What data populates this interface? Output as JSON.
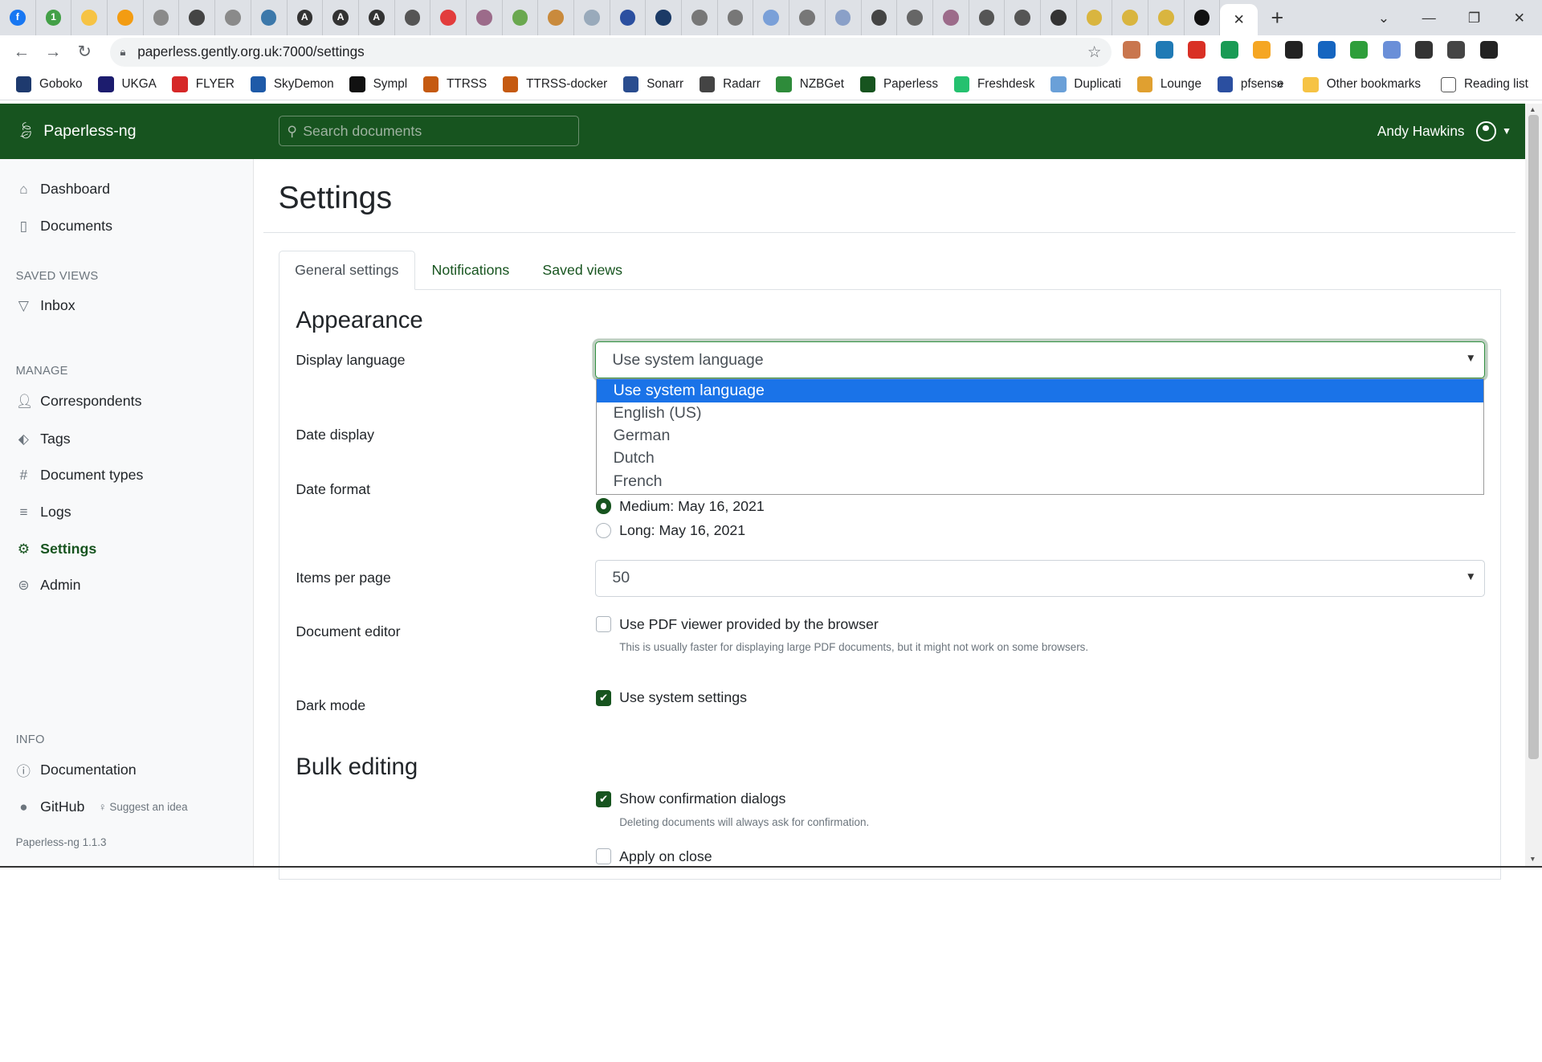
{
  "browser": {
    "favicons": [
      {
        "name": "facebook",
        "color": "#1877f2",
        "glyph": "f"
      },
      {
        "name": "one",
        "color": "#43a047",
        "glyph": "1"
      },
      {
        "name": "note",
        "color": "#f6c344",
        "glyph": ""
      },
      {
        "name": "ring",
        "color": "#f39c12",
        "glyph": ""
      },
      {
        "name": "globe",
        "color": "#8a8a8a",
        "glyph": ""
      },
      {
        "name": "globe-dark",
        "color": "#444",
        "glyph": ""
      },
      {
        "name": "globe2",
        "color": "#8a8a8a",
        "glyph": ""
      },
      {
        "name": "python",
        "color": "#3c78aa",
        "glyph": ""
      },
      {
        "name": "a1",
        "color": "#333",
        "glyph": "A"
      },
      {
        "name": "a2",
        "color": "#333",
        "glyph": "A"
      },
      {
        "name": "a3",
        "color": "#333",
        "glyph": "A"
      },
      {
        "name": "diamond",
        "color": "#555",
        "glyph": ""
      },
      {
        "name": "pce",
        "color": "#e23c3c",
        "glyph": ""
      },
      {
        "name": "u1",
        "color": "#9c6b8a",
        "glyph": ""
      },
      {
        "name": "map",
        "color": "#6aa84f",
        "glyph": ""
      },
      {
        "name": "bars",
        "color": "#c98a3c",
        "glyph": ""
      },
      {
        "name": "cloud",
        "color": "#9ab",
        "glyph": ""
      },
      {
        "name": "pf",
        "color": "#2b4fa0",
        "glyph": ""
      },
      {
        "name": "x",
        "color": "#1b3a66",
        "glyph": ""
      },
      {
        "name": "c1",
        "color": "#777",
        "glyph": ""
      },
      {
        "name": "c2",
        "color": "#777",
        "glyph": ""
      },
      {
        "name": "box",
        "color": "#7aa0d8",
        "glyph": ""
      },
      {
        "name": "c3",
        "color": "#777",
        "glyph": ""
      },
      {
        "name": "gear",
        "color": "#8aa0c8",
        "glyph": ""
      },
      {
        "name": "circle",
        "color": "#444",
        "glyph": ""
      },
      {
        "name": "i",
        "color": "#666",
        "glyph": ""
      },
      {
        "name": "u2",
        "color": "#9c6b8a",
        "glyph": ""
      },
      {
        "name": "g1",
        "color": "#555",
        "glyph": ""
      },
      {
        "name": "g2",
        "color": "#555",
        "glyph": ""
      },
      {
        "name": "htb",
        "color": "#333",
        "glyph": ""
      },
      {
        "name": "py1",
        "color": "#d9b53f",
        "glyph": ""
      },
      {
        "name": "py2",
        "color": "#d9b53f",
        "glyph": ""
      },
      {
        "name": "py3",
        "color": "#d9b53f",
        "glyph": ""
      },
      {
        "name": "github",
        "color": "#111",
        "glyph": ""
      }
    ],
    "active_tab_close": "✕",
    "new_tab": "+",
    "window": {
      "minimize": "—",
      "restore": "❐",
      "close": "✕"
    },
    "url": "paperless.gently.org.uk:7000/settings",
    "extensions": [
      "#c9764e",
      "#1f7ab5",
      "#d93025",
      "#1a9b55",
      "#f5a623",
      "#222",
      "#1565c0",
      "#2e9e3b",
      "#6a8fd8",
      "#333",
      "#444",
      "#222"
    ],
    "bookmarks": [
      {
        "label": "Goboko",
        "color": "#1e3a6e"
      },
      {
        "label": "UKGA",
        "color": "#1c1c6e"
      },
      {
        "label": "FLYER",
        "color": "#d62828"
      },
      {
        "label": "SkyDemon",
        "color": "#1e5aa8"
      },
      {
        "label": "Sympl",
        "color": "#111"
      },
      {
        "label": "TTRSS",
        "color": "#c55a11"
      },
      {
        "label": "TTRSS-docker",
        "color": "#c55a11"
      },
      {
        "label": "Sonarr",
        "color": "#2a4d8f"
      },
      {
        "label": "Radarr",
        "color": "#444"
      },
      {
        "label": "NZBGet",
        "color": "#2e8b3a"
      },
      {
        "label": "Paperless",
        "color": "#17541f"
      },
      {
        "label": "Freshdesk",
        "color": "#25c16f"
      },
      {
        "label": "Duplicati",
        "color": "#6aa0d8"
      },
      {
        "label": "Lounge",
        "color": "#e0a030"
      },
      {
        "label": "pfsense",
        "color": "#2b4fa0"
      }
    ],
    "bookmarks_more": "»",
    "other_bookmarks": "Other bookmarks",
    "reading_list": "Reading list"
  },
  "app": {
    "brand": "Paperless-ng",
    "search_placeholder": "Search documents",
    "user_name": "Andy Hawkins",
    "accent": "#17541f"
  },
  "sidebar": {
    "dashboard": "Dashboard",
    "documents": "Documents",
    "saved_views_heading": "SAVED VIEWS",
    "inbox": "Inbox",
    "manage_heading": "MANAGE",
    "correspondents": "Correspondents",
    "tags": "Tags",
    "document_types": "Document types",
    "logs": "Logs",
    "settings": "Settings",
    "admin": "Admin",
    "info_heading": "INFO",
    "documentation": "Documentation",
    "github": "GitHub",
    "suggest": "Suggest an idea",
    "version": "Paperless-ng 1.1.3"
  },
  "settings": {
    "title": "Settings",
    "tabs": [
      "General settings",
      "Notifications",
      "Saved views"
    ],
    "appearance_heading": "Appearance",
    "display_language_label": "Display language",
    "display_language_value": "Use system language",
    "language_options": [
      "Use system language",
      "English (US)",
      "German",
      "Dutch",
      "French"
    ],
    "date_display_label": "Date display",
    "date_format_label": "Date format",
    "date_format_medium": "Medium: May 16, 2021",
    "date_format_long": "Long: May 16, 2021",
    "items_per_page_label": "Items per page",
    "items_per_page_value": "50",
    "document_editor_label": "Document editor",
    "pdf_viewer_label": "Use PDF viewer provided by the browser",
    "pdf_viewer_hint": "This is usually faster for displaying large PDF documents, but it might not work on some browsers.",
    "dark_mode_label": "Dark mode",
    "dark_mode_option": "Use system settings",
    "bulk_editing_heading": "Bulk editing",
    "show_confirm_label": "Show confirmation dialogs",
    "show_confirm_hint": "Deleting documents will always ask for confirmation.",
    "apply_on_close_label": "Apply on close"
  }
}
